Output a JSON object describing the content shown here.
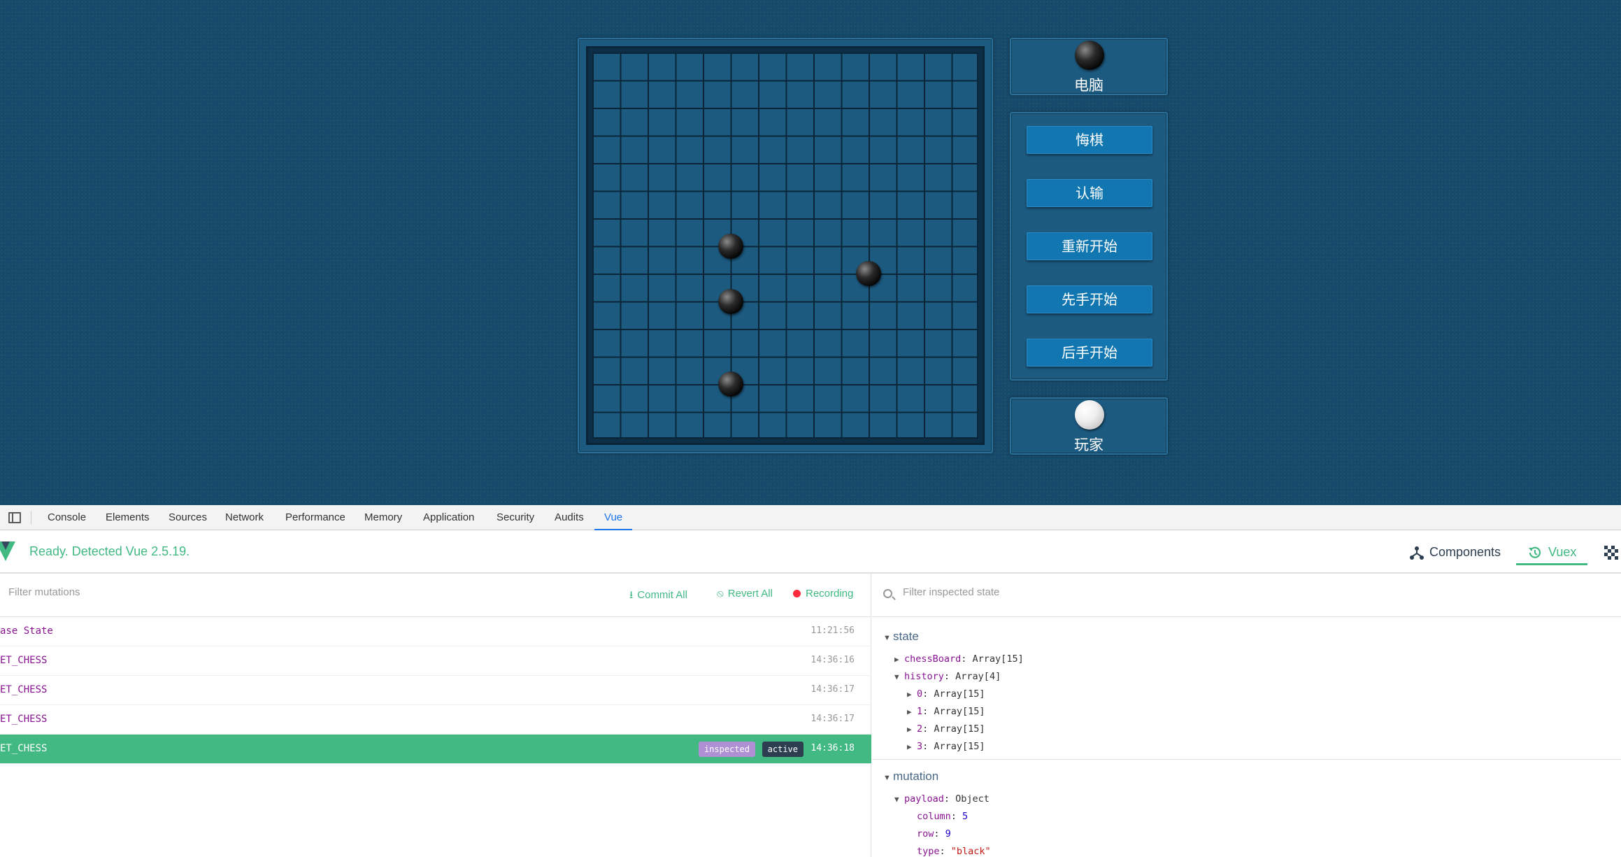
{
  "game": {
    "computer_label": "电脑",
    "player_label": "玩家",
    "buttons": [
      "悔棋",
      "认输",
      "重新开始",
      "先手开始",
      "后手开始"
    ],
    "board_size": 15,
    "stones": [
      {
        "color": "black",
        "col": 5,
        "row": 7
      },
      {
        "color": "black",
        "col": 10,
        "row": 8
      },
      {
        "color": "black",
        "col": 5,
        "row": 9
      },
      {
        "color": "black",
        "col": 5,
        "row": 12
      }
    ],
    "colors": {
      "background": "#164a6a",
      "panel": "#1c5a80",
      "button": "#1277b0"
    }
  },
  "devtools": {
    "tabs": [
      "Console",
      "Elements",
      "Sources",
      "Network",
      "Performance",
      "Memory",
      "Application",
      "Security",
      "Audits",
      "Vue"
    ],
    "active_tab": "Vue",
    "status": "Ready. Detected Vue 2.5.19.",
    "header_buttons": {
      "components": "Components",
      "vuex": "Vuex"
    },
    "mutations": {
      "filter_placeholder": "Filter mutations",
      "commit_all": "Commit All",
      "revert_all": "Revert All",
      "recording": "Recording",
      "rows": [
        {
          "name": "ase State",
          "time": "11:21:56"
        },
        {
          "name": "ET_CHESS",
          "time": "14:36:16"
        },
        {
          "name": "ET_CHESS",
          "time": "14:36:17"
        },
        {
          "name": "ET_CHESS",
          "time": "14:36:17"
        },
        {
          "name": "ET_CHESS",
          "time": "14:36:18"
        }
      ],
      "badge_inspected": "inspected",
      "badge_active": "active"
    },
    "inspector": {
      "filter_placeholder": "Filter inspected state",
      "state_label": "state",
      "mutation_label": "mutation",
      "state": {
        "chessBoard_key": "chessBoard",
        "chessBoard_val": "Array[15]",
        "history_key": "history",
        "history_val": "Array[4]",
        "history_items": [
          {
            "key": "0",
            "val": "Array[15]"
          },
          {
            "key": "1",
            "val": "Array[15]"
          },
          {
            "key": "2",
            "val": "Array[15]"
          },
          {
            "key": "3",
            "val": "Array[15]"
          }
        ]
      },
      "mutation": {
        "payload_key": "payload",
        "payload_val": "Object",
        "column_key": "column",
        "column_val": "5",
        "row_key": "row",
        "row_val": "9",
        "type_key": "type",
        "type_val": "\"black\""
      }
    },
    "colors": {
      "vue_green": "#42b983",
      "vue_dark": "#2c3e50",
      "badge_purple": "#af90d5"
    }
  }
}
